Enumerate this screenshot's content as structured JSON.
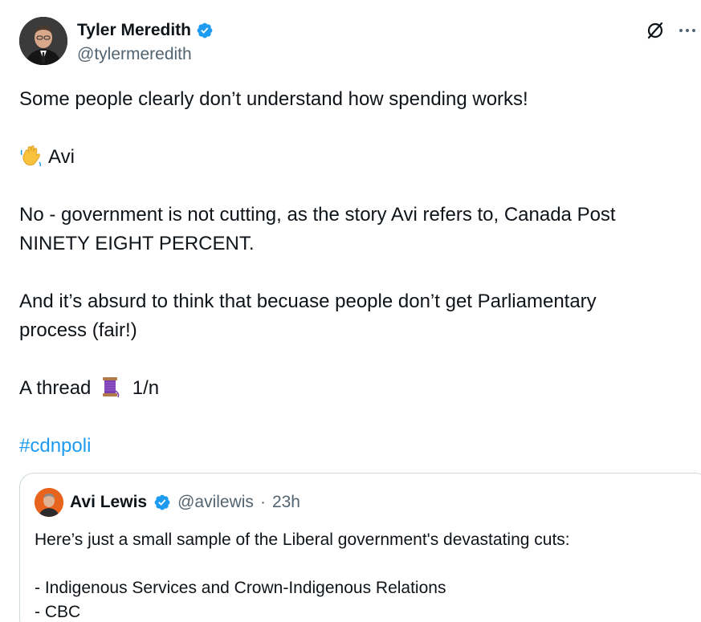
{
  "author": {
    "display_name": "Tyler Meredith",
    "handle": "@tylermeredith",
    "verified": true
  },
  "header_actions": [
    {
      "icon": "grok-icon"
    },
    {
      "icon": "more-icon",
      "label": "···"
    }
  ],
  "body": {
    "line1": "Some people clearly don’t understand how spending works!",
    "line2_emoji": "waving-hand-emoji",
    "line2_text": "Avi",
    "line3": "No - government is not cutting, as the story Avi refers to, Canada Post",
    "line4": "NINETY EIGHT PERCENT.",
    "line5": "And it’s absurd to think that becuase people don’t get Parliamentary",
    "line6": "process (fair!)",
    "line7_text_before": "A thread",
    "line7_emoji": "thread-spool-emoji",
    "line7_text_after": "1/n",
    "hashtag": "#cdnpoli"
  },
  "quote": {
    "display_name": "Avi Lewis",
    "handle": "@avilewis",
    "separator": "·",
    "time": "23h",
    "verified": true,
    "line1": "Here’s just a small sample of the Liberal government's devastating cuts:",
    "line2": "- Indigenous Services and Crown-Indigenous Relations",
    "line3": "- CBC"
  },
  "colors": {
    "text": "#0f1419",
    "secondary": "#536471",
    "link": "#1d9bf0",
    "verified": "#1d9bf0",
    "border": "#cfd9de"
  }
}
